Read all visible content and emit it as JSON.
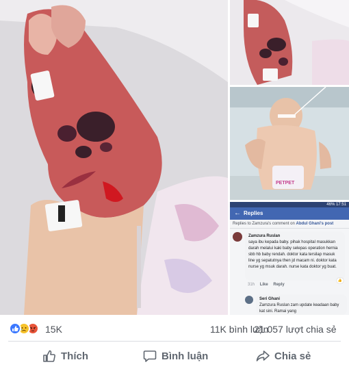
{
  "photos": {
    "main": "foot-with-blisters-photo",
    "right_top": "foot-closeup-photo",
    "right_mid": "baby-in-hospital-photo",
    "right_bot": "facebook-replies-screenshot"
  },
  "embedded_screenshot": {
    "status_bar": "46% 17:51",
    "header_title": "Replies",
    "context_prefix": "Replies to Zamzura's comment on ",
    "context_link": "Abdul Ghani's post",
    "comments": [
      {
        "name": "Zamzura Ruslan",
        "text": "saya ibu kepada baby. pihak hospital masukkan darah melalui kaki baby selepas operation hernia sbb hb baby rendah. doktor kata tersilap masuk line yg sepatutnya then jd macam ni. doktor kata nurse yg msuk darah. nurse kata doktor yg buat.",
        "time": "31h",
        "like": "Like",
        "reply": "Reply"
      },
      {
        "name": "Seri Ghani",
        "text": "Zamzura Ruslan zam update keadaan baby kat sini. Ramai yang"
      }
    ]
  },
  "reactions": {
    "icons": [
      "like-icon",
      "sad-icon",
      "angry-icon"
    ],
    "count": "15K"
  },
  "stats": {
    "comments": "11K bình luận",
    "shares": "21.057 lượt chia sẻ"
  },
  "actions": {
    "like": "Thích",
    "comment": "Bình luận",
    "share": "Chia sẻ"
  },
  "colors": {
    "facebook_blue": "#4267b2",
    "action_text": "#606770",
    "like_blue": "#3b78ff",
    "sad_yellow": "#f7c32b",
    "angry_red": "#e9553a"
  }
}
